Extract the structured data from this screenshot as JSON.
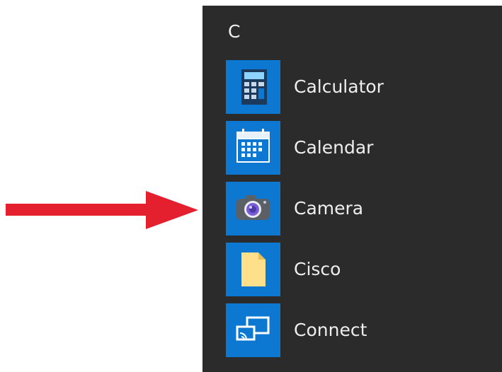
{
  "start_menu": {
    "group_letter": "C",
    "apps": [
      {
        "label": "Calculator",
        "icon": "calculator-icon"
      },
      {
        "label": "Calendar",
        "icon": "calendar-icon"
      },
      {
        "label": "Camera",
        "icon": "camera-icon"
      },
      {
        "label": "Cisco",
        "icon": "folder-icon"
      },
      {
        "label": "Connect",
        "icon": "connect-icon"
      }
    ]
  },
  "colors": {
    "panel_background": "#2b2b2b",
    "tile_accent": "#0c78d2",
    "annotation_arrow": "#e5202e",
    "text": "#eeeeee"
  }
}
